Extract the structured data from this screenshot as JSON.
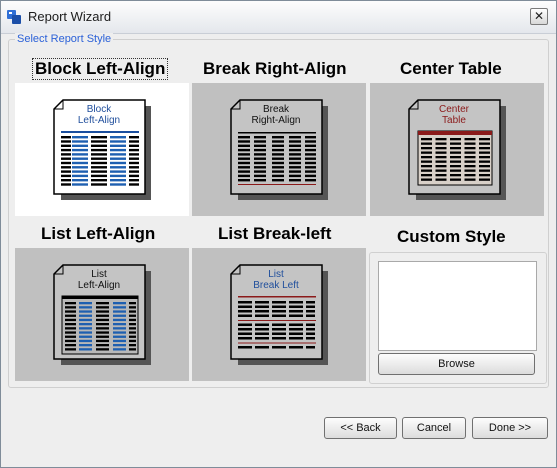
{
  "window": {
    "title": "Report Wizard",
    "close_glyph": "✕"
  },
  "group": {
    "legend": "Select Report Style"
  },
  "styles": [
    {
      "label": "Block Left-Align",
      "doc_title": [
        "Block",
        "Left-Align"
      ],
      "selected": true
    },
    {
      "label": "Break Right-Align",
      "doc_title": [
        "Break",
        "Right-Align"
      ],
      "selected": false
    },
    {
      "label": "Center Table",
      "doc_title": [
        "Center",
        "Table"
      ],
      "selected": false
    },
    {
      "label": "List Left-Align",
      "doc_title": [
        "List",
        "Left-Align"
      ],
      "selected": false
    },
    {
      "label": "List Break-left",
      "doc_title": [
        "List",
        "Break Left"
      ],
      "selected": false
    },
    {
      "label": "Custom Style",
      "selected": false
    }
  ],
  "custom": {
    "browse_label": "Browse"
  },
  "footer": {
    "back_label": "<< Back",
    "cancel_label": "Cancel",
    "done_label": "Done >>"
  },
  "colors": {
    "legend": "#2b61d8",
    "blue_title": "#1f4e9c",
    "red_title": "#8b1a1a",
    "tile_gray": "#c0c0c0"
  },
  "icons": [
    "app-icon",
    "close-icon",
    "document-icon"
  ]
}
